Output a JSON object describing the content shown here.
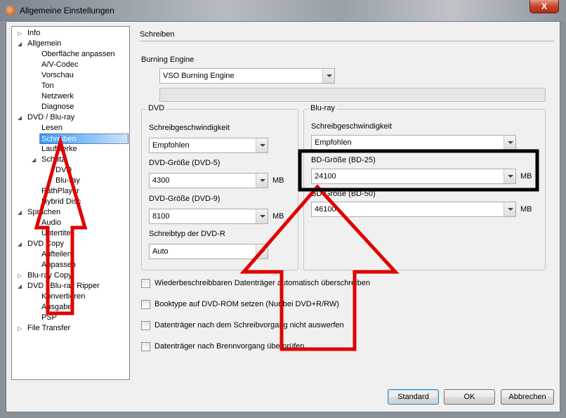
{
  "window": {
    "title": "Allgemeine Einstellungen",
    "close": "X"
  },
  "tree": [
    {
      "label": "Info",
      "level": 0,
      "tw": "closed"
    },
    {
      "label": "Allgemein",
      "level": 0,
      "tw": "open"
    },
    {
      "label": "Oberfläche anpassen",
      "level": 1
    },
    {
      "label": "A/V-Codec",
      "level": 1
    },
    {
      "label": "Vorschau",
      "level": 1
    },
    {
      "label": "Ton",
      "level": 1
    },
    {
      "label": "Netzwerk",
      "level": 1
    },
    {
      "label": "Diagnose",
      "level": 1
    },
    {
      "label": "DVD / Blu-ray",
      "level": 0,
      "tw": "open"
    },
    {
      "label": "Lesen",
      "level": 1
    },
    {
      "label": "Schreiben",
      "level": 1,
      "selected": true
    },
    {
      "label": "Laufwerke",
      "level": 1
    },
    {
      "label": "Schutz",
      "level": 1,
      "tw": "open"
    },
    {
      "label": "DVD",
      "level": 2
    },
    {
      "label": "Blu-ray",
      "level": 2
    },
    {
      "label": "PathPlayer",
      "level": 1
    },
    {
      "label": "Hybrid Disc",
      "level": 1
    },
    {
      "label": "Sprachen",
      "level": 0,
      "tw": "open"
    },
    {
      "label": "Audio",
      "level": 1
    },
    {
      "label": "Untertitel",
      "level": 1
    },
    {
      "label": "DVD Copy",
      "level": 0,
      "tw": "open"
    },
    {
      "label": "Aufteilen",
      "level": 1
    },
    {
      "label": "Anpassen",
      "level": 1
    },
    {
      "label": "Blu-ray Copy",
      "level": 0,
      "tw": "closed"
    },
    {
      "label": "DVD / Blu-ray Ripper",
      "level": 0,
      "tw": "open"
    },
    {
      "label": "Konvertieren",
      "level": 1
    },
    {
      "label": "Ausgabe",
      "level": 1
    },
    {
      "label": "PSP",
      "level": 1
    },
    {
      "label": "File Transfer",
      "level": 0,
      "tw": "closed"
    }
  ],
  "main": {
    "section_title": "Schreiben",
    "engine_label": "Burning Engine",
    "engine_value": "VSO Burning Engine",
    "dvd": {
      "title": "DVD",
      "speed_label": "Schreibgeschwindigkeit",
      "speed_value": "Empfohlen",
      "dvd5_label": "DVD-Größe (DVD-5)",
      "dvd5_value": "4300",
      "dvd9_label": "DVD-Größe (DVD-9)",
      "dvd9_value": "8100",
      "unit": "MB",
      "type_label": "Schreibtyp der DVD-R",
      "type_value": "Auto"
    },
    "bluray": {
      "title": "Blu-ray",
      "speed_label": "Schreibgeschwindigkeit",
      "speed_value": "Empfohlen",
      "bd25_label": "BD-Größe (BD-25)",
      "bd25_value": "24100",
      "bd50_label": "BD-Größe (BD-50)",
      "bd50_value": "46100",
      "unit": "MB"
    },
    "checkboxes": [
      {
        "label": "Wiederbeschreibbaren Datenträger automatisch überschreiben",
        "checked": false
      },
      {
        "label": "Booktype auf DVD-ROM setzen (Nur bei DVD+R/RW)",
        "checked": false
      },
      {
        "label": "Datenträger nach dem Schreibvorgang nicht auswerfen",
        "checked": false
      },
      {
        "label": "Datenträger nach Brennvorgang überprüfen",
        "checked": false
      }
    ]
  },
  "buttons": {
    "standard": "Standard",
    "ok": "OK",
    "cancel": "Abbrechen"
  },
  "annotation_color": "#e00000"
}
